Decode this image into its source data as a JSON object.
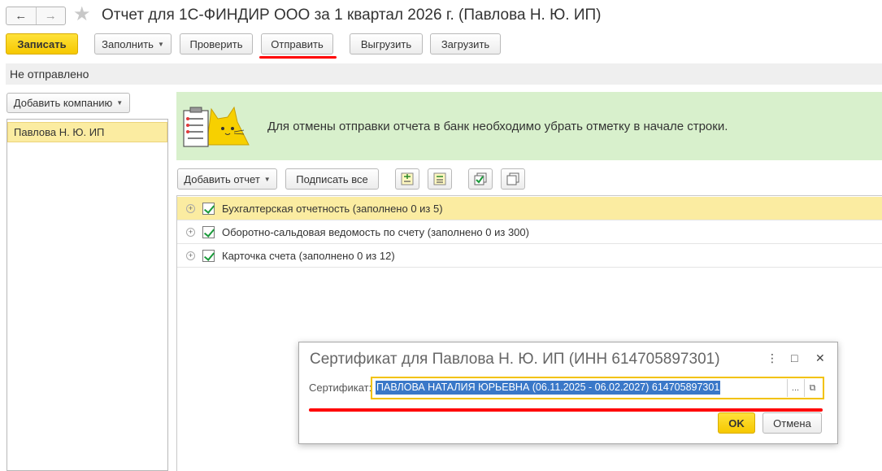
{
  "window": {
    "title": "Отчет для 1С-ФИНДИР ООО за 1 квартал 2026 г. (Павлова Н. Ю. ИП)",
    "back_icon": "←",
    "forward_icon": "→",
    "favorite_icon": "★"
  },
  "toolbar": {
    "save_label": "Записать",
    "fill_label": "Заполнить",
    "check_label": "Проверить",
    "send_label": "Отправить",
    "export_label": "Выгрузить",
    "import_label": "Загрузить"
  },
  "status": {
    "text": "Не отправлено"
  },
  "companies": {
    "add_label": "Добавить компанию",
    "items": [
      {
        "label": "Павлова Н. Ю. ИП"
      }
    ]
  },
  "info": {
    "message": "Для отмены отправки отчета в банк необходимо убрать отметку в начале строки."
  },
  "reports_toolbar": {
    "add_report_label": "Добавить отчет",
    "sign_all_label": "Подписать все"
  },
  "reports": [
    {
      "label": "Бухгалтерская отчетность (заполнено 0 из 5)",
      "checked": true
    },
    {
      "label": "Оборотно-сальдовая ведомость по счету (заполнено 0 из 300)",
      "checked": true
    },
    {
      "label": "Карточка счета (заполнено 0 из 12)",
      "checked": true
    }
  ],
  "dialog": {
    "title": "Сертификат для Павлова Н. Ю. ИП (ИНН 614705897301)",
    "more_icon": "⋮",
    "maximize_icon": "□",
    "close_icon": "✕",
    "certificate_label": "Сертификат:",
    "certificate_value": "ПАВЛОВА НАТАЛИЯ ЮРЬЕВНА (06.11.2025 - 06.02.2027)  614705897301",
    "choose_icon": "...",
    "open_icon": "⧉",
    "ok_label": "OK",
    "cancel_label": "Отмена"
  },
  "colors": {
    "primary_button": "#f6c800",
    "highlight": "#fbeca1",
    "info_background": "#d8f0cc",
    "annotation_red": "#ff0000",
    "selection_blue": "#3a78c8"
  }
}
